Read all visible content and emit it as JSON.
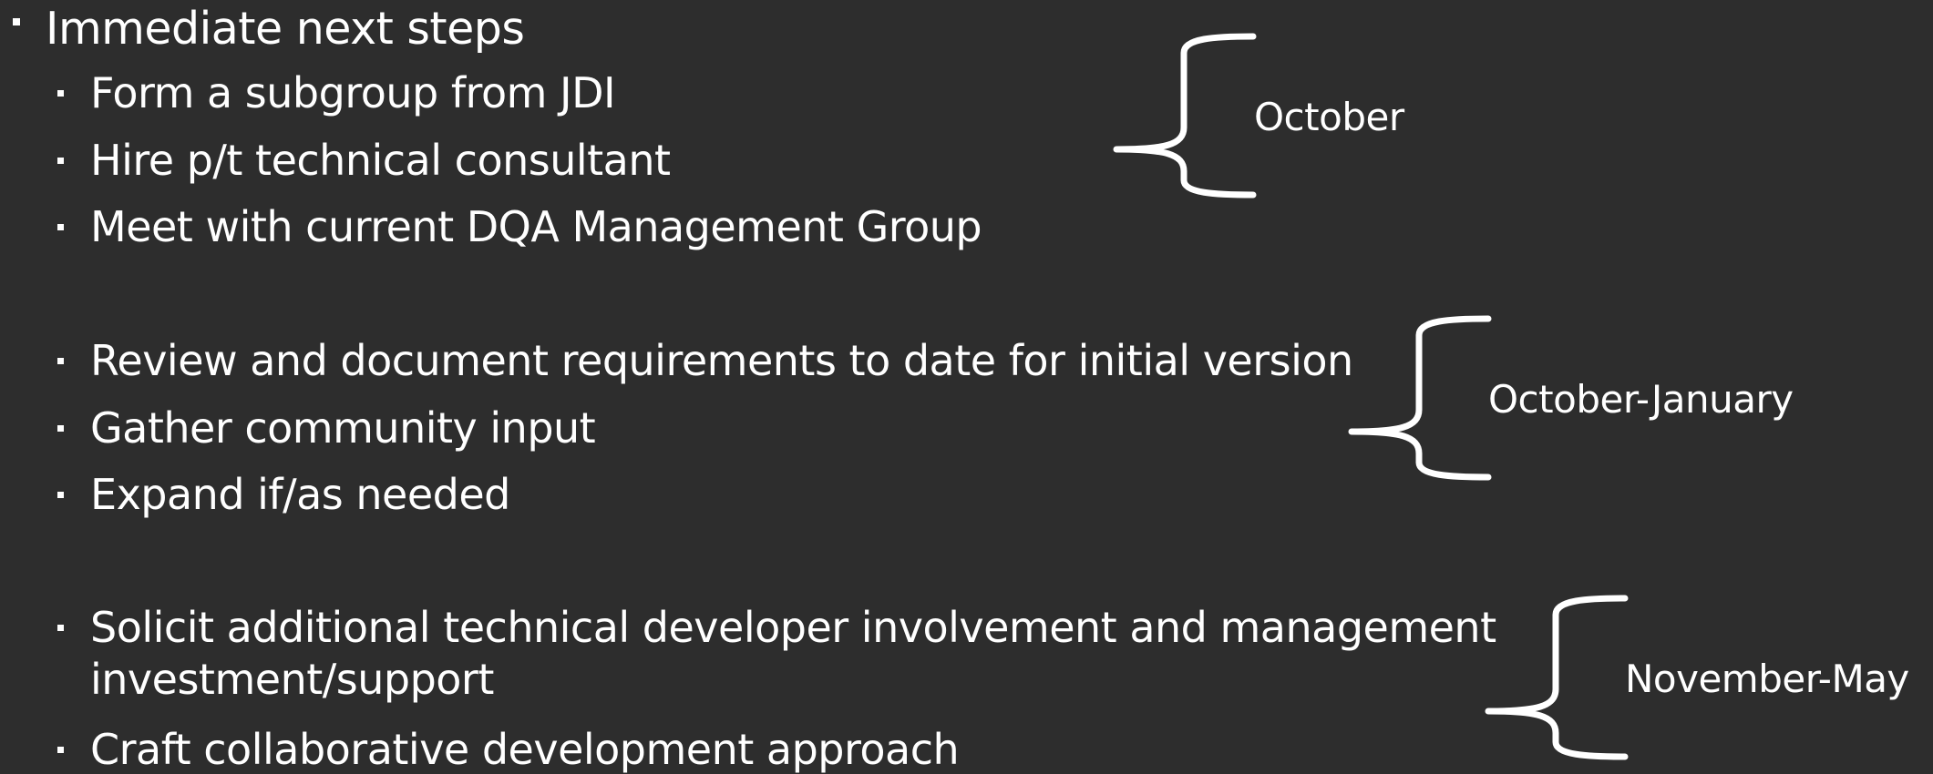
{
  "heading": "Immediate next steps",
  "groups": [
    {
      "items": [
        "Form a subgroup from JDI",
        "Hire p/t technical consultant",
        "Meet with current DQA Management Group"
      ],
      "timeframe": "October"
    },
    {
      "items": [
        "Review and document requirements to date for initial version",
        "Gather community input",
        "Expand if/as needed"
      ],
      "timeframe": "October-January"
    },
    {
      "items": [
        "Solicit additional technical developer involvement and management",
        "investment/support",
        "Craft collaborative development approach"
      ],
      "timeframe": "November-May"
    }
  ],
  "colors": {
    "background": "#2d2d2d",
    "text": "#ffffff"
  }
}
